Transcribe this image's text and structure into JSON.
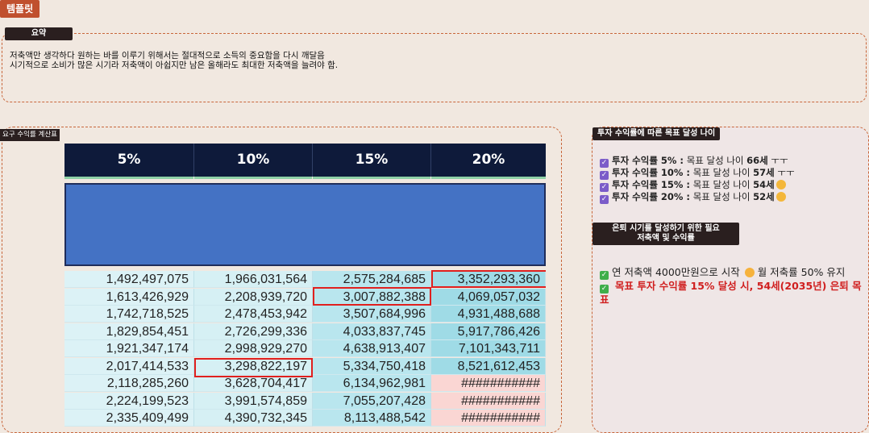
{
  "template_tag": "템플릿",
  "summary": {
    "label": "요약",
    "lines": [
      "저축액만 생각하다 원하는 바를 이루기 위해서는 절대적으로 소득의 중요함을 다시 깨달음",
      "시기적으로 소비가 많은 시기라 저축액이 아쉽지만 남은 올해라도 최대한 저축액을 늘려야 함."
    ]
  },
  "calc": {
    "label": "요구 수익률 계산표",
    "headers": [
      "5%",
      "10%",
      "15%",
      "20%"
    ],
    "rows": [
      [
        "1,492,497,075",
        "1,966,031,564",
        "2,575,284,685",
        "3,352,293,360"
      ],
      [
        "1,613,426,929",
        "2,208,939,720",
        "3,007,882,388",
        "4,069,057,032"
      ],
      [
        "1,742,718,525",
        "2,478,453,942",
        "3,507,684,996",
        "4,931,488,688"
      ],
      [
        "1,829,854,451",
        "2,726,299,336",
        "4,033,837,745",
        "5,917,786,426"
      ],
      [
        "1,921,347,174",
        "2,998,929,270",
        "4,638,913,407",
        "7,101,343,711"
      ],
      [
        "2,017,414,533",
        "3,298,822,197",
        "5,334,750,418",
        "8,521,612,453"
      ],
      [
        "2,118,285,260",
        "3,628,704,417",
        "6,134,962,981",
        "###########"
      ],
      [
        "2,224,199,523",
        "3,991,574,859",
        "7,055,207,428",
        "###########"
      ],
      [
        "2,335,409,499",
        "4,390,732,345",
        "8,113,488,542",
        "###########"
      ]
    ]
  },
  "goals": {
    "label": "투자 수익률에 따른 목표 달성 나이",
    "items": [
      {
        "bold": "투자 수익률 5% :",
        "rest": " 목표 달성 나이 ",
        "age": "66세",
        "tail": " ㅜㅜ"
      },
      {
        "bold": "투자 수익률 10% :",
        "rest": " 목표 달성 나이 ",
        "age": "57세",
        "tail": " ㅜㅜ"
      },
      {
        "bold": "투자 수익률 15% :",
        "rest": " 목표 달성 나이 ",
        "age": "54세",
        "tail": ""
      },
      {
        "bold": "투자 수익률 20% :",
        "rest": " 목표 달성 나이 ",
        "age": "52세",
        "tail": ""
      }
    ]
  },
  "plan": {
    "label_line1": "은퇴 시기를 달성하기 위한 필요",
    "label_line2": "저축액 및 수익률",
    "item1_a": "연 저축액 4000만원으로 시작",
    "item1_b": "월 저축률 50% 유지",
    "item2": "목표 투자 수익률 15% 달성 시, 54세(2035년) 은퇴 목표"
  },
  "colors": {
    "accent": "#c0502e",
    "header_bg": "#0e1a3a",
    "blue_block": "#4472c4",
    "highlight": "#e0201e"
  }
}
